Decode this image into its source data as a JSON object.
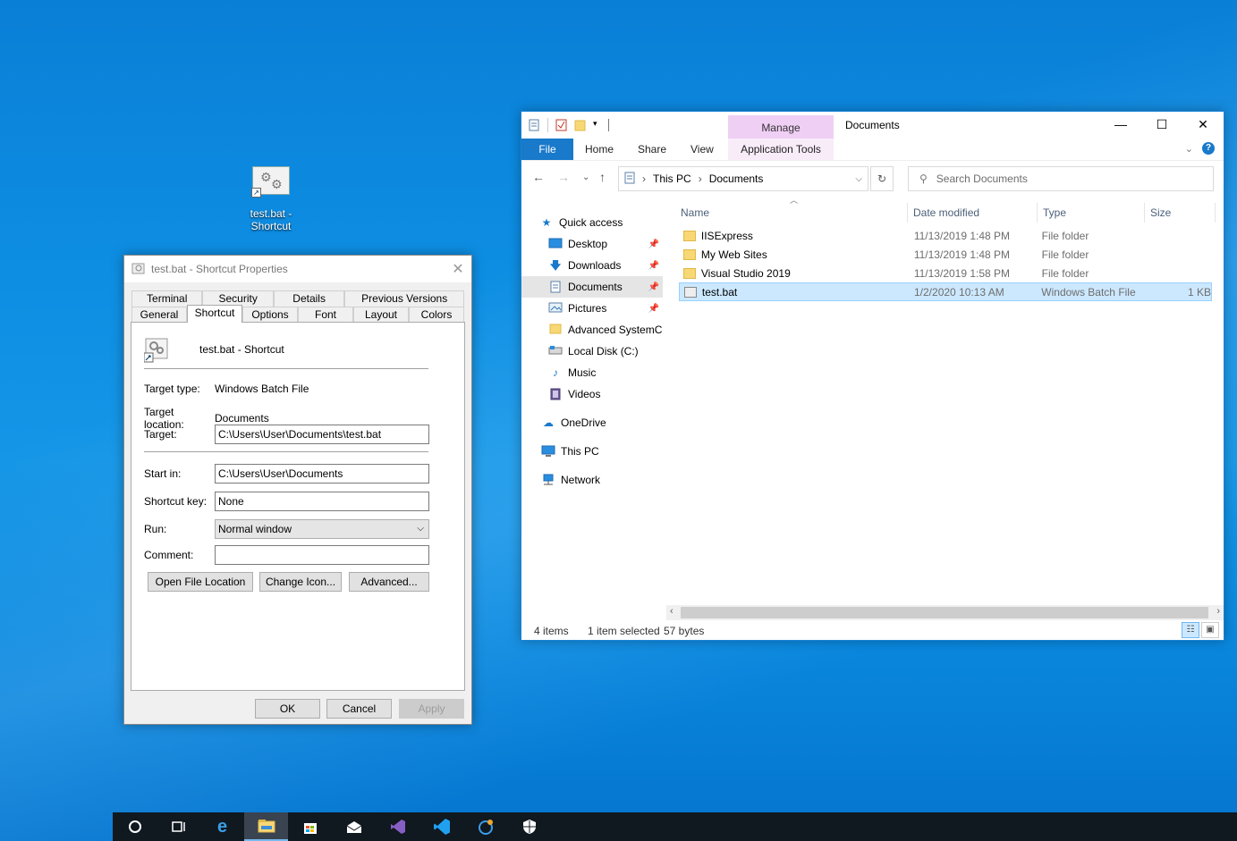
{
  "desktop": {
    "shortcut_label": "test.bat - Shortcut"
  },
  "properties_dialog": {
    "title": "test.bat - Shortcut Properties",
    "tabs_row1": [
      "Terminal",
      "Security",
      "Details",
      "Previous Versions"
    ],
    "tabs_row2": [
      "General",
      "Shortcut",
      "Options",
      "Font",
      "Layout",
      "Colors"
    ],
    "selected_tab": "Shortcut",
    "shortcut_name": "test.bat - Shortcut",
    "target_type_label": "Target type:",
    "target_type": "Windows Batch File",
    "target_location_label": "Target location:",
    "target_location": "Documents",
    "target_label": "Target:",
    "target": "C:\\Users\\User\\Documents\\test.bat",
    "start_in_label": "Start in:",
    "start_in": "C:\\Users\\User\\Documents",
    "shortcut_key_label": "Shortcut key:",
    "shortcut_key": "None",
    "run_label": "Run:",
    "run": "Normal window",
    "comment_label": "Comment:",
    "comment": "",
    "buttons": {
      "open_file_location": "Open File Location",
      "change_icon": "Change Icon...",
      "advanced": "Advanced...",
      "ok": "OK",
      "cancel": "Cancel",
      "apply": "Apply"
    }
  },
  "explorer": {
    "title": "Documents",
    "manage_label": "Manage",
    "ribbon_tabs": {
      "file": "File",
      "home": "Home",
      "share": "Share",
      "view": "View",
      "app_tools": "Application Tools"
    },
    "breadcrumb": [
      "This PC",
      "Documents"
    ],
    "search_placeholder": "Search Documents",
    "nav": {
      "quick_access": "Quick access",
      "desktop": "Desktop",
      "downloads": "Downloads",
      "documents": "Documents",
      "pictures": "Pictures",
      "advanced_systemc": "Advanced SystemC",
      "local_disk": "Local Disk (C:)",
      "music": "Music",
      "videos": "Videos",
      "onedrive": "OneDrive",
      "this_pc": "This PC",
      "network": "Network"
    },
    "columns": {
      "name": "Name",
      "date": "Date modified",
      "type": "Type",
      "size": "Size"
    },
    "files": [
      {
        "name": "IISExpress",
        "date": "11/13/2019 1:48 PM",
        "type": "File folder",
        "size": ""
      },
      {
        "name": "My Web Sites",
        "date": "11/13/2019 1:48 PM",
        "type": "File folder",
        "size": ""
      },
      {
        "name": "Visual Studio 2019",
        "date": "11/13/2019 1:58 PM",
        "type": "File folder",
        "size": ""
      },
      {
        "name": "test.bat",
        "date": "1/2/2020 10:13 AM",
        "type": "Windows Batch File",
        "size": "1 KB"
      }
    ],
    "status": {
      "items": "4 items",
      "selected": "1 item selected",
      "bytes": "57 bytes"
    }
  }
}
